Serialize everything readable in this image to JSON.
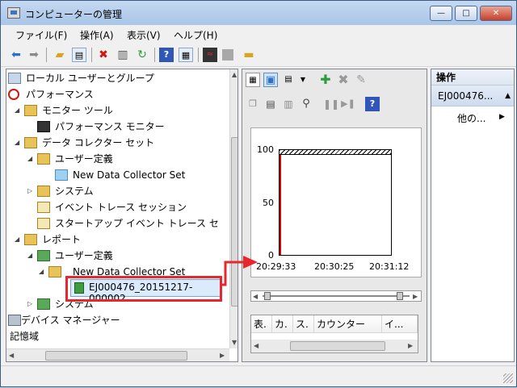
{
  "window": {
    "title": "コンピューターの管理",
    "buttons": {
      "minimize": "—",
      "maximize": "□",
      "close": "✕"
    }
  },
  "menu": [
    {
      "label": "ファイル(F)"
    },
    {
      "label": "操作(A)"
    },
    {
      "label": "表示(V)"
    },
    {
      "label": "ヘルプ(H)"
    }
  ],
  "toolbar_icons": [
    "back-arrow-icon",
    "forward-arrow-icon",
    "up-folder-icon",
    "show-hide-tree-icon",
    "delete-icon",
    "print-icon",
    "refresh-icon",
    "help-icon",
    "show-hide-action-pane-icon",
    "monitor-icon",
    "stop-icon",
    "folder-icon"
  ],
  "tree": {
    "items": [
      {
        "label": "ローカル ユーザーとグループ"
      },
      {
        "label": "パフォーマンス"
      },
      {
        "label": "モニター ツール"
      },
      {
        "label": "パフォーマンス モニター"
      },
      {
        "label": "データ コレクター セット"
      },
      {
        "label": "ユーザー定義"
      },
      {
        "label": "New Data Collector Set"
      },
      {
        "label": "システム"
      },
      {
        "label": "イベント トレース セッション"
      },
      {
        "label": "スタートアップ イベント トレース セ"
      },
      {
        "label": "レポート"
      },
      {
        "label": "ユーザー定義"
      },
      {
        "label": "New Data Collector Set"
      },
      {
        "label": "EJ000476_20151217-000002"
      },
      {
        "label": "システム"
      },
      {
        "label": "デバイス マネージャー"
      },
      {
        "label": "記憶域"
      }
    ]
  },
  "graph": {
    "y_ticks": [
      "100",
      "50",
      "0"
    ],
    "x_ticks": [
      "20:29:33",
      "20:30:25",
      "20:31:12"
    ]
  },
  "counter_table": {
    "columns": [
      "表.",
      "カ.",
      "ス.",
      "カウンター",
      "イ..."
    ]
  },
  "actions": {
    "header": "操作",
    "section": "EJ000476...",
    "more": "他の..."
  },
  "colors": {
    "highlight": "#e8262d",
    "graph_line": "#d00000",
    "titlebar": "#c5d9f1"
  }
}
